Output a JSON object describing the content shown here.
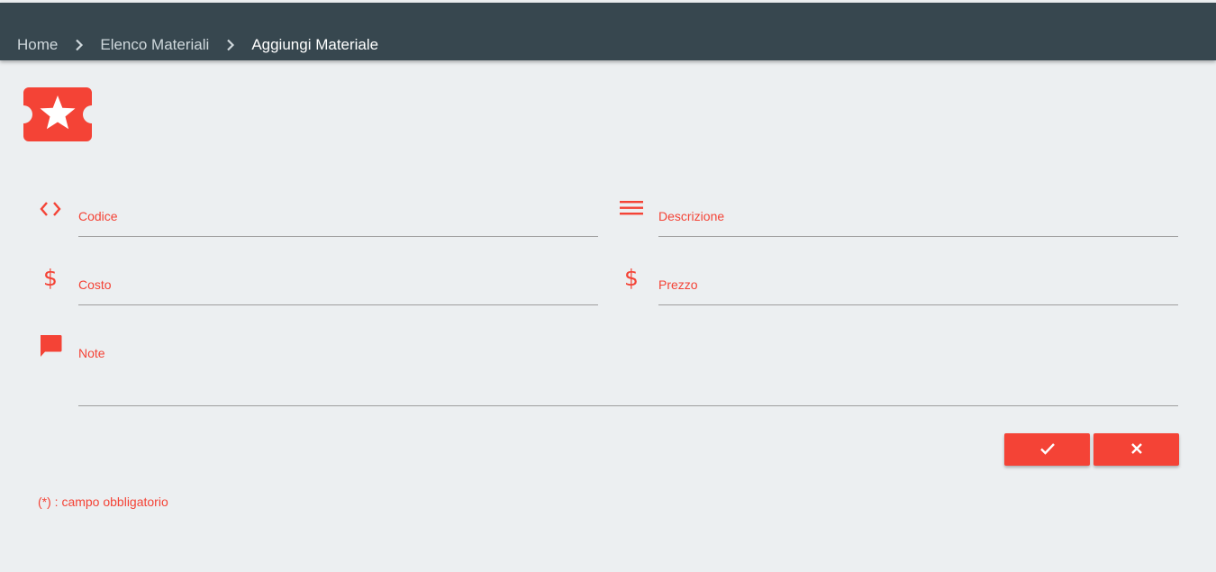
{
  "breadcrumb": {
    "items": [
      {
        "label": "Home"
      },
      {
        "label": "Elenco Materiali"
      },
      {
        "label": "Aggiungi Materiale"
      }
    ]
  },
  "logo": {
    "icon": "ticket-star-icon",
    "color": "#f44336"
  },
  "form": {
    "codice": {
      "label": "Codice",
      "icon": "code-icon",
      "value": ""
    },
    "descrizione": {
      "label": "Descrizione",
      "icon": "menu-lines-icon",
      "value": ""
    },
    "costo": {
      "label": "Costo",
      "icon": "dollar-icon",
      "value": ""
    },
    "prezzo": {
      "label": "Prezzo",
      "icon": "dollar-icon",
      "value": ""
    },
    "note": {
      "label": "Note",
      "icon": "comment-icon",
      "value": ""
    }
  },
  "actions": {
    "confirm": {
      "icon": "check-icon"
    },
    "cancel": {
      "icon": "close-icon"
    }
  },
  "footer": {
    "required_note": "(*) : campo obbligatorio"
  },
  "colors": {
    "accent": "#f44336",
    "navbar": "#37474f",
    "background": "#eceff1"
  }
}
